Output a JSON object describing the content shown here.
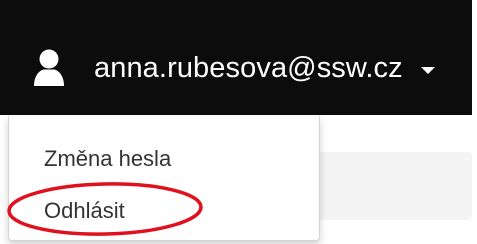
{
  "navbar": {
    "background": "#0c0c0c",
    "user": {
      "icon": "user-icon",
      "email": "anna.rubesova@ssw.cz",
      "caret_icon": "caret-down-icon"
    }
  },
  "dropdown": {
    "items": [
      {
        "label": "Změna hesla"
      },
      {
        "label": "Odhlásit"
      }
    ]
  },
  "annotation": {
    "highlight_color": "#e0101e"
  }
}
